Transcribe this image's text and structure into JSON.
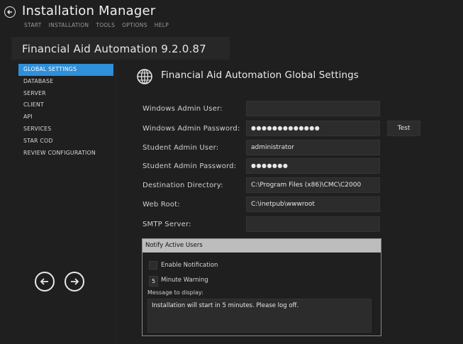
{
  "header": {
    "title": "Installation Manager",
    "menu": [
      "START",
      "INSTALLATION",
      "TOOLS",
      "OPTIONS",
      "HELP"
    ]
  },
  "product": {
    "title": "Financial Aid Automation 9.2.0.87"
  },
  "sidebar": {
    "items": [
      {
        "label": "GLOBAL SETTINGS",
        "active": true
      },
      {
        "label": "DATABASE"
      },
      {
        "label": "SERVER"
      },
      {
        "label": "CLIENT"
      },
      {
        "label": "API"
      },
      {
        "label": "SERVICES"
      },
      {
        "label": "STAR COD"
      },
      {
        "label": "REVIEW CONFIGURATION"
      }
    ]
  },
  "main": {
    "section_title": "Financial Aid Automation Global Settings",
    "fields": {
      "windows_admin_user": {
        "label": "Windows Admin User:",
        "value": ""
      },
      "windows_admin_password": {
        "label": "Windows Admin Password:",
        "value": "●●●●●●●●●●●●●"
      },
      "student_admin_user": {
        "label": "Student Admin User:",
        "value": "administrator"
      },
      "student_admin_password": {
        "label": "Student Admin Password:",
        "value": "●●●●●●●"
      },
      "destination_directory": {
        "label": "Destination Directory:",
        "value": "C:\\Program Files (x86)\\CMC\\C2000"
      },
      "web_root": {
        "label": "Web Root:",
        "value": "C:\\inetpub\\wwwroot"
      },
      "smtp_server": {
        "label": "SMTP Server:",
        "value": ""
      }
    },
    "test_button": "Test",
    "notify": {
      "title": "Notify Active Users",
      "enable_label": "Enable Notification",
      "enable_checked": false,
      "minutes": "5",
      "minute_label": "Minute Warning",
      "message_label": "Message to display:",
      "message": "Installation will start in 5 minutes. Please log off."
    }
  },
  "colors": {
    "background": "#1f1f1f",
    "accent": "#2f8fd8",
    "field": "#2c2c2c",
    "group_header": "#bdbdbd"
  },
  "icons": {
    "back": "back-arrow-circle-icon",
    "section": "globe-icon",
    "nav_prev": "arrow-left-circle-icon",
    "nav_next": "arrow-right-circle-icon"
  }
}
